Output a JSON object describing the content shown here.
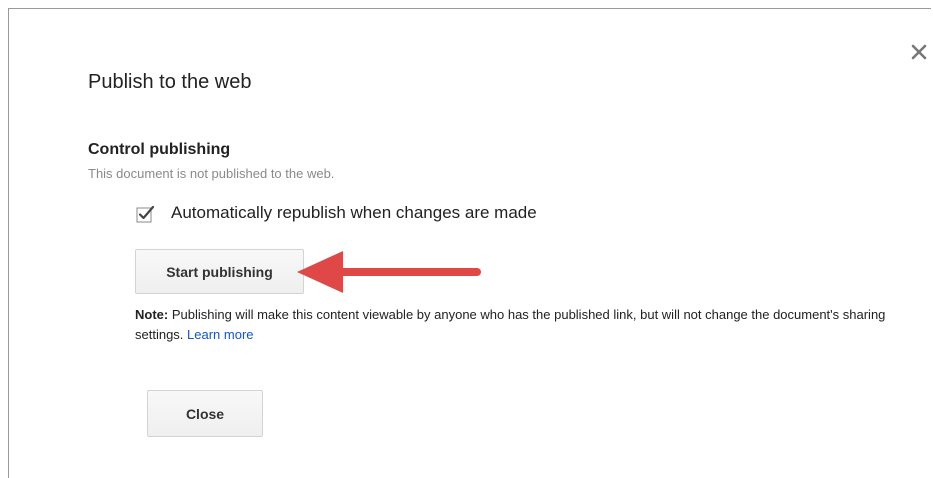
{
  "dialog": {
    "title": "Publish to the web",
    "close_icon": "close-icon",
    "section_heading": "Control publishing",
    "status_text": "This document is not published to the web.",
    "auto_republish": {
      "checked": true,
      "label": "Automatically republish when changes are made"
    },
    "start_button_label": "Start publishing",
    "annotation_arrow_color": "#e04848",
    "note": {
      "prefix": "Note:",
      "text": " Publishing will make this content viewable by anyone who has the published link, but will not change the document's sharing settings. ",
      "link_label": "Learn more",
      "link_color": "#1155cc"
    },
    "close_button_label": "Close"
  }
}
